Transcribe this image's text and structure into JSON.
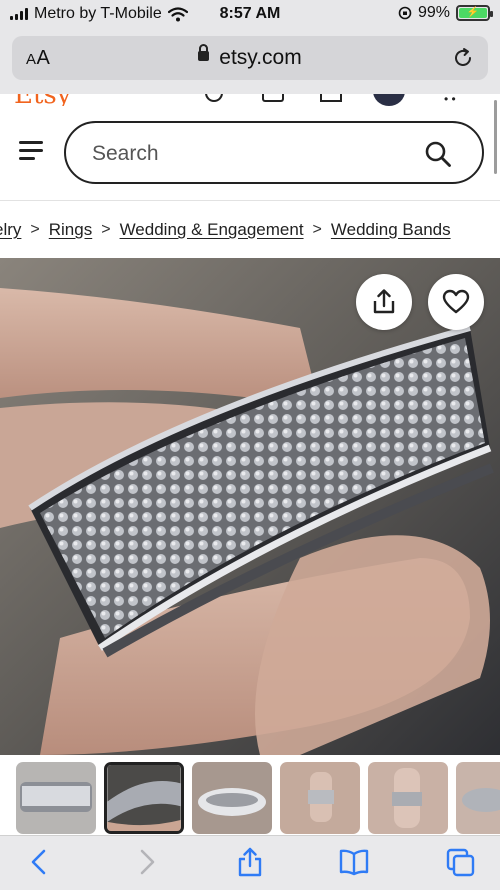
{
  "status_bar": {
    "carrier": "Metro by T-Mobile",
    "time": "8:57 AM",
    "battery": "99%"
  },
  "browser": {
    "aa_label_small": "A",
    "aa_label_large": "A",
    "url": "etsy.com"
  },
  "header": {
    "search_placeholder": "Search"
  },
  "breadcrumb": [
    "elry",
    "Rings",
    "Wedding & Engagement",
    "Wedding Bands"
  ],
  "breadcrumb_separator": ">",
  "colors": {
    "etsy_orange": "#f1641e",
    "safari_chrome": "#e7e7e9",
    "toolbar_blue": "#2f7bf5",
    "battery_green": "#4cd964"
  },
  "icons": {
    "share": "share-icon",
    "favorite": "heart-icon",
    "search": "magnifier-icon",
    "menu": "hamburger-icon"
  },
  "thumbnails": {
    "count": 6,
    "selected_index": 1
  }
}
